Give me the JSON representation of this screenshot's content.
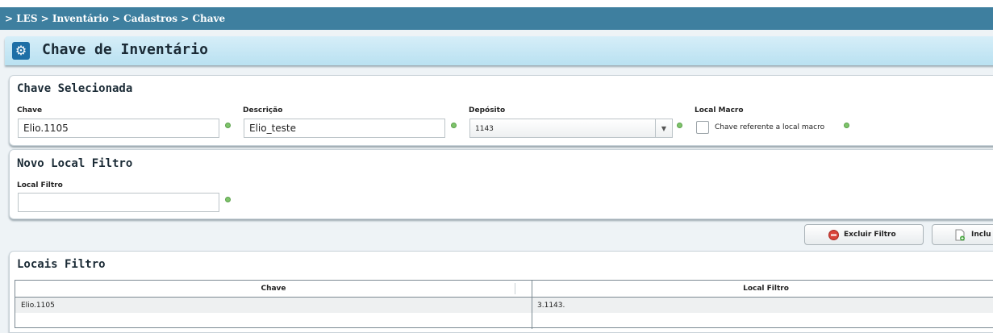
{
  "breadcrumb": "> LES > Inventário > Cadastros > Chave",
  "page_title": "Chave de Inventário",
  "chave_selecionada": {
    "title": "Chave Selecionada",
    "chave_label": "Chave",
    "chave_value": "Elio.1105",
    "descricao_label": "Descrição",
    "descricao_value": "Elio_teste",
    "deposito_label": "Depósito",
    "deposito_value": "1143",
    "local_macro_label": "Local Macro",
    "local_macro_checkbox_label": "Chave referente a local macro"
  },
  "novo_local_filtro": {
    "title": "Novo Local Filtro",
    "local_filtro_label": "Local Filtro",
    "local_filtro_value": ""
  },
  "actions": {
    "excluir_label": "Excluir Filtro",
    "incluir_label": "Inclu"
  },
  "locais_filtro": {
    "title": "Locais Filtro",
    "columns": [
      "Chave",
      "Local Filtro"
    ],
    "rows": [
      [
        "Elio.1105",
        "3.1143."
      ]
    ]
  },
  "colors": {
    "breadcrumb_bg": "#3e7f9f",
    "title_icon_bg": "#1e6fa6",
    "valid_dot": "#7fc46b",
    "delete_icon": "#d9433a"
  },
  "icons": {
    "title": "gear-icon",
    "excluir": "delete-icon",
    "incluir": "add-document-icon"
  }
}
